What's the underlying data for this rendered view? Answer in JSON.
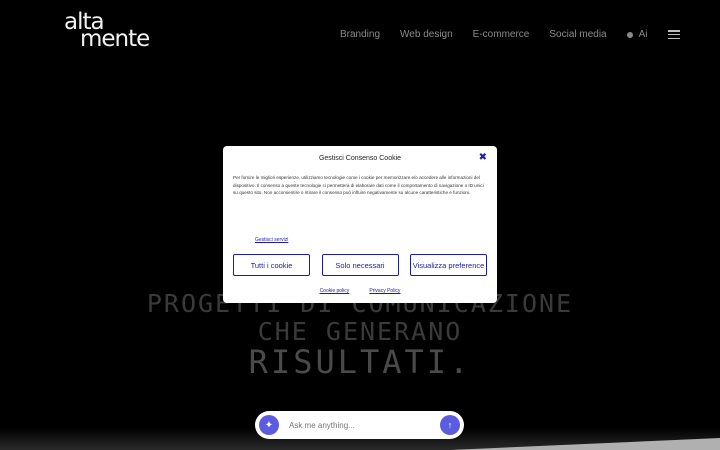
{
  "header": {
    "logo_line1": "alta",
    "logo_line2": "mente",
    "nav": [
      "Branding",
      "Web design",
      "E-commerce",
      "Social media"
    ],
    "ai_label": "Ai"
  },
  "hero": {
    "line1": "PROGETTI DI COMUNICAZIONE",
    "line2": "CHE GENERANO",
    "line3": "RISULTATI."
  },
  "chat": {
    "placeholder": "Ask me anything...",
    "spark_icon": "✦",
    "send_icon": "↑"
  },
  "cookie_modal": {
    "title": "Gestisci Consenso Cookie",
    "close_glyph": "✖",
    "body": "Per fornire le migliori esperienze, utilizziamo tecnologie come i cookie per memorizzare e/o accedere alle informazioni del dispositivo. Il consenso a queste tecnologie ci permetterà di elaborare dati come il comportamento di navigazione o ID unici su questo sito. Non acconsentire o ritirare il consenso può influire negativamente su alcune caratteristiche e funzioni.",
    "services_link": "Gestisci servizi",
    "buttons": {
      "accept_all": "Tutti i cookie",
      "necessary_only": "Solo necessari",
      "view_preferences": "Visualizza preference"
    },
    "links": {
      "cookie_policy": "Cookie policy",
      "privacy_policy": "Privacy Policy"
    },
    "accent_color": "#1c1ca8"
  },
  "colors": {
    "background": "#000000",
    "chat_accent": "#5b5ce0"
  }
}
